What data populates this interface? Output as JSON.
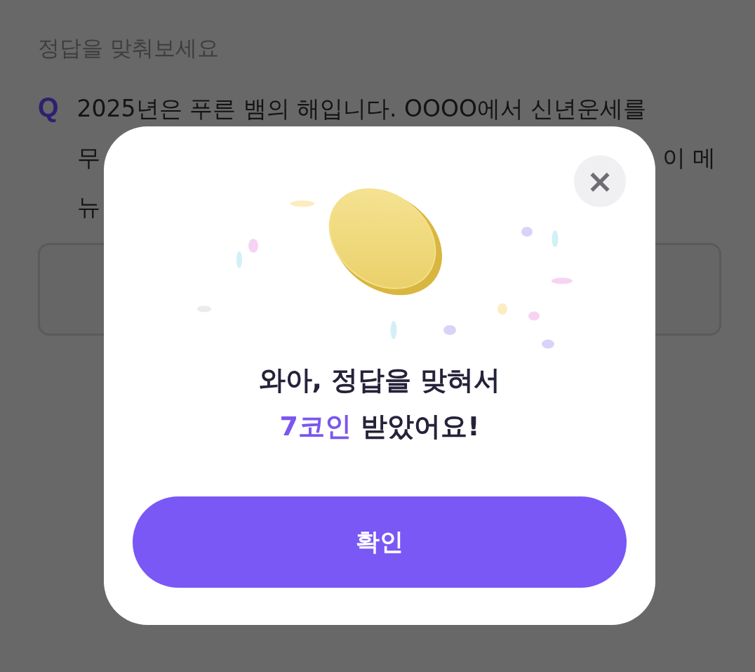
{
  "page": {
    "heading": "정답을 맞춰보세요",
    "question_mark": "Q",
    "question_lines": [
      [
        "2025년은 푸른 뱀의 해입니다. OOOO에서 신년운세를"
      ],
      [
        "무",
        "이 메"
      ],
      [
        "뉴"
      ]
    ]
  },
  "dialog": {
    "close_label": "×",
    "title": "와아, 정답을 맞혀서",
    "reward": {
      "amount": "7코인",
      "rest": "받았어요!"
    },
    "confirm_button": "확인"
  }
}
